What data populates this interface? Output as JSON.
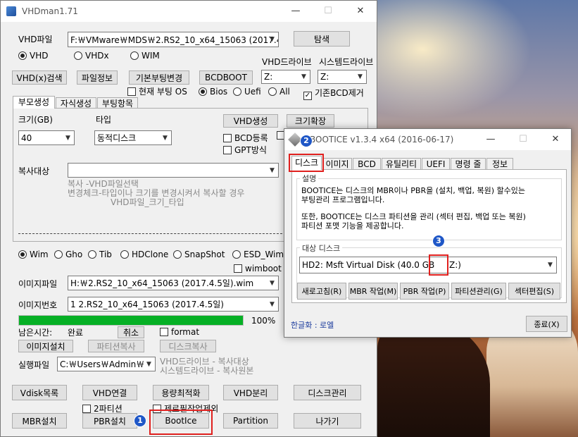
{
  "main": {
    "title": "VHDman1.71",
    "vhd_file_label": "VHD파일",
    "vhd_file_value": "F:￦VMware￦MDS￦2.RS2_10_x64_15063 (2017.4.",
    "browse": "탐색",
    "radio_vhd": "VHD",
    "radio_vhdx": "VHDx",
    "radio_wim": "WIM",
    "vhd_drive_label": "VHD드라이브",
    "system_drive_label": "시스템드라이브",
    "btn_vhdx_search": "VHD(x)검색",
    "btn_file_info": "파일정보",
    "btn_default_boot": "기본부팅변경",
    "btn_bcdboot": "BCDBOOT",
    "vhd_drive_value": "Z:",
    "system_drive_value": "Z:",
    "current_boot_os": "현재 부팅 OS",
    "bios": "Bios",
    "uefi": "Uefi",
    "all": "All",
    "remove_bcd": "기존BCD제거",
    "tabs": [
      "부모생성",
      "자식생성",
      "부팅항목"
    ],
    "size_label": "크기(GB)",
    "type_label": "타입",
    "size_value": "40",
    "type_value": "동적디스크",
    "btn_vhd_create": "VHD생성",
    "btn_size_expand": "크기확장",
    "bcd_register": "BCD등록",
    "gpt_mode": "GPT방식",
    "copy_target_label": "복사대상",
    "hint_lines": [
      "복사      -VHD파일선택",
      "변경체크-타입이나 크기를 변경시켜서 복사할 경우",
      "VHD파일_크기_타입"
    ],
    "wim_options": [
      "Wim",
      "Gho",
      "Tib",
      "HDClone",
      "SnapShot",
      "ESD_Wim"
    ],
    "wimboot": "wimboot",
    "image_file_label": "이미지파일",
    "image_file_value": "H:￦2.RS2_10_x64_15063 (2017.4.5일).wim",
    "image_number_label": "이미지번호",
    "image_number_value": "1  2.RS2_10_x64_15063 (2017.4.5일)",
    "progress_percent": 100,
    "progress_text": "100%",
    "remaining_label": "남은시간:",
    "remaining_value": "완료",
    "btn_cancel": "취소",
    "format": "format",
    "btn_image_install": "이미지설치",
    "btn_partition_copy": "파티션복사",
    "btn_disk_copy": "디스크복사",
    "exec_file_label": "실행파일",
    "exec_file_value": "C:￦Users￦Admin￦",
    "exec_hint1": "VHD드라이브 - 복사대상",
    "exec_hint2": "시스템드라이브 - 복사원본",
    "btn_vdisk_list": "Vdisk목록",
    "btn_vhd_connect": "VHD연결",
    "btn_optimize": "용량최적화",
    "btn_vhd_detach": "VHD분리",
    "btn_disk_mgmt": "디스크관리",
    "two_partition": "2파티션",
    "zero_fill_except": "제로필작업제외",
    "btn_mbr_install": "MBR설치",
    "btn_pbr_install": "PBR설치",
    "btn_bootice": "BootIce",
    "btn_partition": "Partition",
    "btn_exit": "나가기"
  },
  "bootice": {
    "title": "BOOTICE v1.3.4 x64 (2016-06-17)",
    "tabs": [
      "디스크",
      "이미지",
      "BCD",
      "유틸리티",
      "UEFI",
      "명령 줄",
      "정보"
    ],
    "desc_group": "설명",
    "desc_lines": [
      "BOOTICE는 디스크의 MBR이나 PBR을 (설치, 백업, 복원) 할수있는",
      "부팅관리 프로그램입니다.",
      "",
      "또한, BOOTICE는 디스크 파티션을 관리 (섹터 편집, 백업 또는 복원)",
      "파티션 포맷 기능을 제공합니다."
    ],
    "target_group": "대상 디스크",
    "target_value": "HD2: Msft Virtual Disk (40.0 GB",
    "target_drive": "Z:)",
    "btn_refresh": "새로고침(R)",
    "btn_mbr": "MBR 작업(M)",
    "btn_pbr": "PBR 작업(P)",
    "btn_partmgmt": "파티션관리(G)",
    "btn_sector": "섹터편집(S)",
    "localization": "한글화 : 로엘",
    "btn_close": "종료(X)"
  },
  "badges": [
    "1",
    "2",
    "3"
  ],
  "colors": {
    "progress": "#06b025",
    "highlight": "#e0201e",
    "badge": "#1f57c7"
  }
}
